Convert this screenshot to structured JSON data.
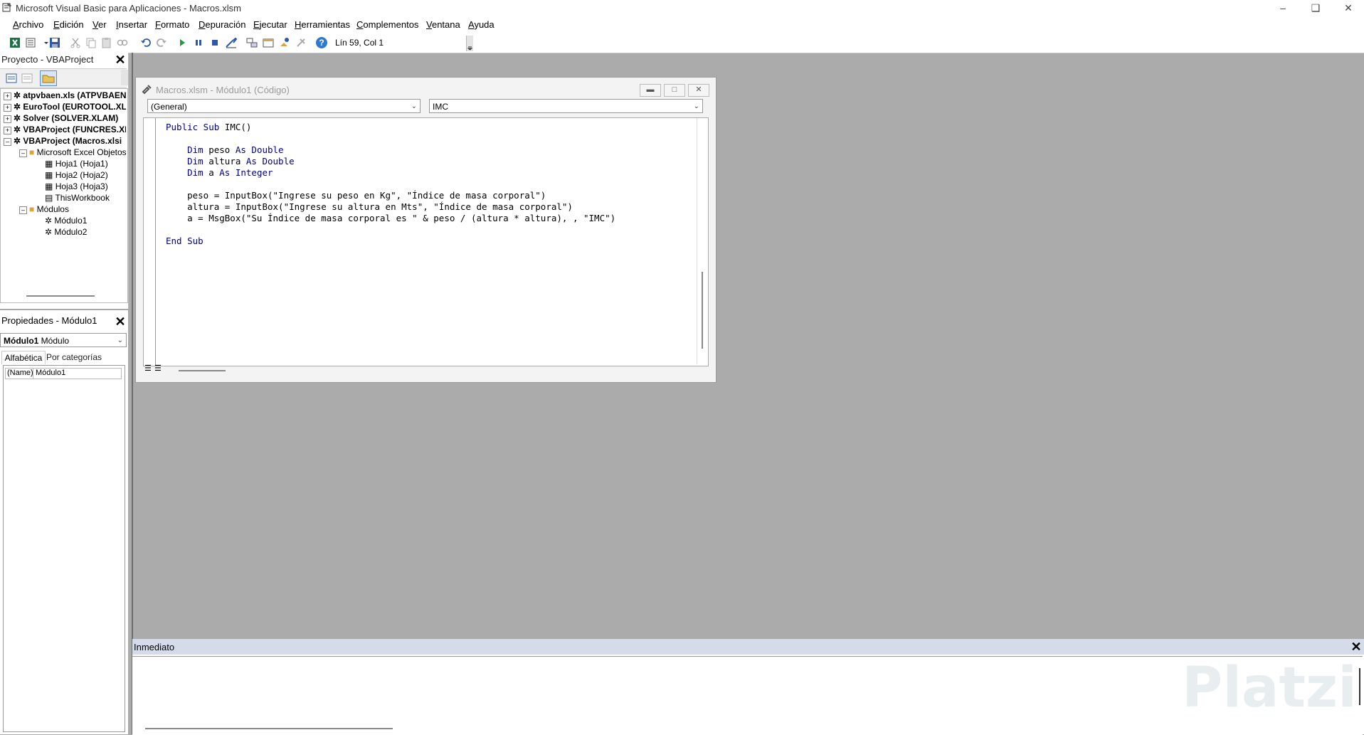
{
  "window": {
    "title": "Microsoft Visual Basic para Aplicaciones - Macros.xlsm"
  },
  "menu": [
    "Archivo",
    "Edición",
    "Ver",
    "Insertar",
    "Formato",
    "Depuración",
    "Ejecutar",
    "Herramientas",
    "Complementos",
    "Ventana",
    "Ayuda"
  ],
  "toolbar": {
    "position": "Lín 59, Col 1"
  },
  "project": {
    "title": "Proyecto - VBAProject",
    "tree": [
      "atpvbaen.xls (ATPVBAEN",
      "EuroTool (EUROTOOL.XL",
      "Solver (SOLVER.XLAM)",
      "VBAProject (FUNCRES.XL",
      "VBAProject (Macros.xlsi",
      "Microsoft Excel Objetos",
      "Hoja1 (Hoja1)",
      "Hoja2 (Hoja2)",
      "Hoja3 (Hoja3)",
      "ThisWorkbook",
      "Módulos",
      "Módulo1",
      "Módulo2"
    ]
  },
  "properties": {
    "title": "Propiedades - Módulo1",
    "object_name": "Módulo1",
    "object_type": "Módulo",
    "tab_alpha": "Alfabética",
    "tab_cat": "Por categorías",
    "prop_name": "(Name)",
    "prop_value": "Módulo1"
  },
  "codewin": {
    "title": "Macros.xlsm - Módulo1 (Código)",
    "object_combo": "(General)",
    "proc_combo": "IMC",
    "lines": [
      "Public Sub IMC()",
      "",
      "    Dim peso As Double",
      "    Dim altura As Double",
      "    Dim a As Integer",
      "",
      "    peso = InputBox(\"Ingrese su peso en Kg\", \"Índice de masa corporal\")",
      "    altura = InputBox(\"Ingrese su altura en Mts\", \"Índice de masa corporal\")",
      "    a = MsgBox(\"Su Índice de masa corporal es \" & peso / (altura * altura), , \"IMC\")",
      "",
      "End Sub"
    ]
  },
  "immediate": {
    "title": "Inmediato"
  },
  "watermark": "Platzi"
}
